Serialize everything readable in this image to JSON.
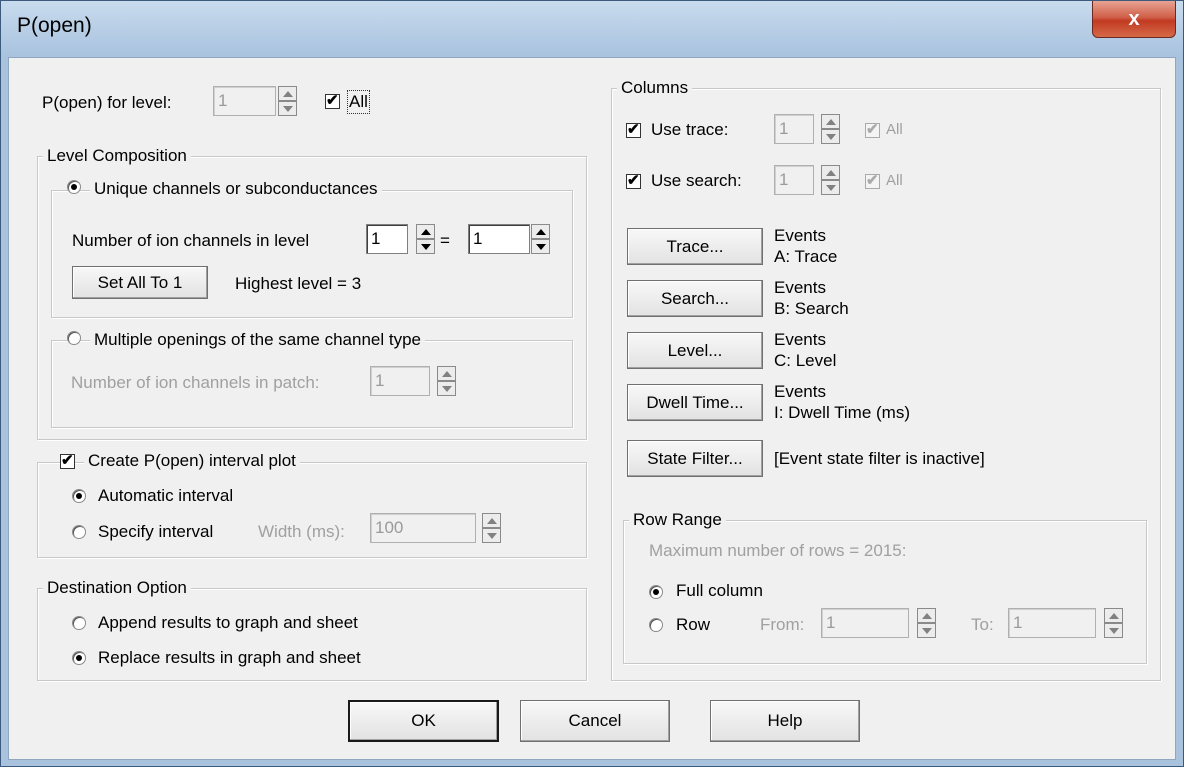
{
  "window": {
    "title": "P(open)",
    "close_glyph": "x"
  },
  "popen_level": {
    "label": "P(open) for level:",
    "value": "1",
    "all_label": "All",
    "all_checked": true
  },
  "level_composition": {
    "title": "Level Composition",
    "unique": {
      "label": "Unique channels or subconductances",
      "channels_label": "Number of ion channels in level",
      "value1": "1",
      "equals": "=",
      "value2": "1",
      "set_all_label": "Set All To 1",
      "highest_level": "Highest level = 3"
    },
    "multiple": {
      "label": "Multiple openings of the same channel type",
      "patch_label": "Number of ion channels in patch:",
      "patch_value": "1"
    }
  },
  "interval_plot": {
    "label": "Create P(open) interval plot",
    "checked": true,
    "automatic_label": "Automatic interval",
    "specify_label": "Specify interval",
    "width_label": "Width (ms):",
    "width_value": "100"
  },
  "destination": {
    "title": "Destination Option",
    "append_label": "Append results to graph and sheet",
    "replace_label": "Replace results in graph and sheet"
  },
  "columns": {
    "title": "Columns",
    "use_trace_label": "Use trace:",
    "use_trace_value": "1",
    "use_search_label": "Use search:",
    "use_search_value": "1",
    "all_label": "All",
    "buttons": [
      {
        "label": "Trace...",
        "line1": "Events",
        "line2": "A: Trace"
      },
      {
        "label": "Search...",
        "line1": "Events",
        "line2": "B: Search"
      },
      {
        "label": "Level...",
        "line1": "Events",
        "line2": "C: Level"
      },
      {
        "label": "Dwell Time...",
        "line1": "Events",
        "line2": "I: Dwell Time (ms)"
      }
    ],
    "state_filter_label": "State Filter...",
    "state_filter_status": "[Event state filter is inactive]"
  },
  "row_range": {
    "title": "Row Range",
    "max_rows": "Maximum number of rows = 2015:",
    "full_column_label": "Full column",
    "row_label": "Row",
    "from_label": "From:",
    "from_value": "1",
    "to_label": "To:",
    "to_value": "1"
  },
  "footer": {
    "ok_label": "OK",
    "cancel_label": "Cancel",
    "help_label": "Help"
  }
}
